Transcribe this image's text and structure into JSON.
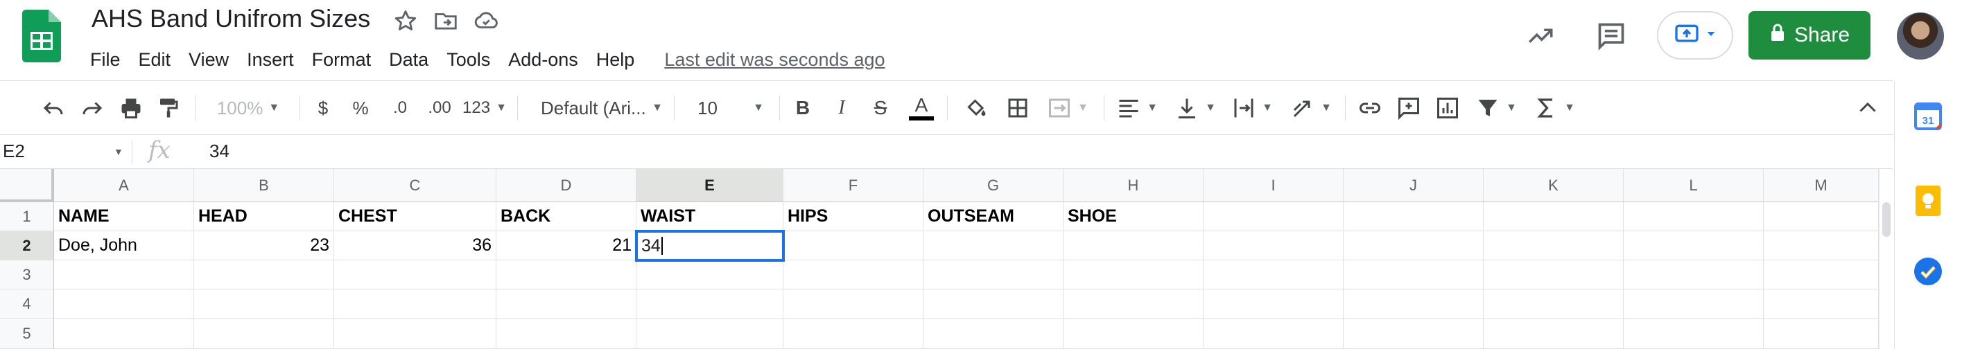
{
  "doc": {
    "title": "AHS Band Unifrom Sizes",
    "last_edit": "Last edit was seconds ago"
  },
  "menu": [
    "File",
    "Edit",
    "View",
    "Insert",
    "Format",
    "Data",
    "Tools",
    "Add-ons",
    "Help"
  ],
  "toolbar": {
    "zoom": "100%",
    "currency": "$",
    "percent": "%",
    "dec_decrease": ".0",
    "dec_increase": ".00",
    "more_formats": "123",
    "font": "Default (Ari...",
    "font_size": "10",
    "bold": "B",
    "italic": "I",
    "strike": "S",
    "text_color": "A"
  },
  "share": {
    "label": "Share"
  },
  "formula_bar": {
    "name_box": "E2",
    "fx": "fx",
    "value": "34"
  },
  "columns": [
    "A",
    "B",
    "C",
    "D",
    "E",
    "F",
    "G",
    "H",
    "I",
    "J",
    "K",
    "L",
    "M"
  ],
  "rows": [
    "1",
    "2",
    "3",
    "4",
    "5"
  ],
  "sheet": {
    "r1": [
      "NAME",
      "HEAD",
      "CHEST",
      "BACK",
      "WAIST",
      "HIPS",
      "OUTSEAM",
      "SHOE"
    ],
    "r2": [
      "Doe, John",
      "23",
      "36",
      "21",
      "34"
    ]
  },
  "colors": {
    "accent": "#1a73e8",
    "share_green": "#1e8e3e",
    "sheets_green": "#0f9d58"
  },
  "icons": {
    "header": [
      "star-icon",
      "move-to-folder-icon",
      "cloud-saved-icon",
      "trending-icon",
      "comments-icon",
      "present-icon",
      "lock-icon"
    ],
    "side": [
      "google-calendar-icon",
      "google-keep-icon",
      "google-tasks-icon"
    ]
  }
}
